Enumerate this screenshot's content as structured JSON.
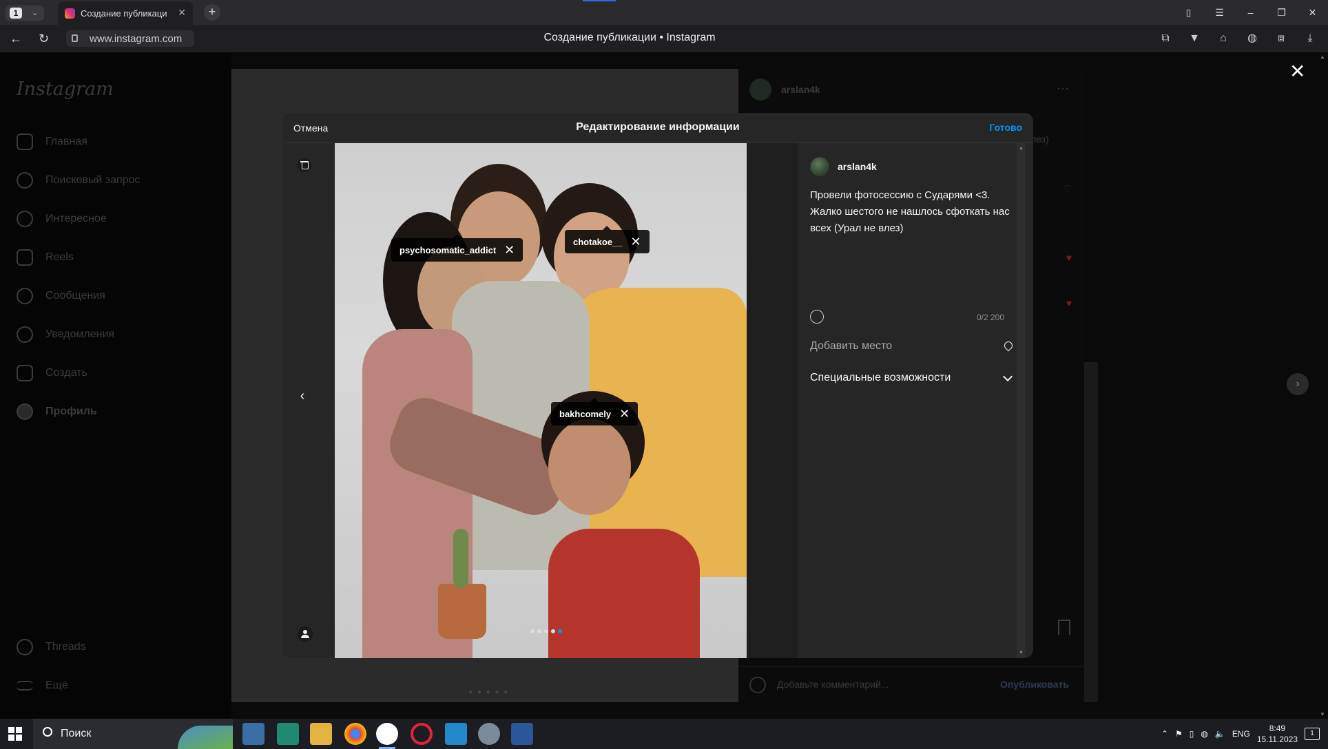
{
  "browser": {
    "tab_count": "1",
    "tab_title": "Создание публикаци",
    "url": "www.instagram.com",
    "page_title": "Создание публикации • Instagram"
  },
  "sidebar": {
    "logo": "Instagram",
    "items": [
      {
        "label": "Главная",
        "icon": "home-icon"
      },
      {
        "label": "Поисковый запрос",
        "icon": "search-icon"
      },
      {
        "label": "Интересное",
        "icon": "compass-icon"
      },
      {
        "label": "Reels",
        "icon": "reels-icon"
      },
      {
        "label": "Сообщения",
        "icon": "messenger-icon"
      },
      {
        "label": "Уведомления",
        "icon": "heart-icon"
      },
      {
        "label": "Создать",
        "icon": "plus-icon"
      },
      {
        "label": "Профиль",
        "icon": "avatar"
      }
    ],
    "bottom": [
      {
        "label": "Threads",
        "icon": "threads-icon"
      },
      {
        "label": "Ещё",
        "icon": "menu-icon"
      }
    ]
  },
  "background_post": {
    "username": "arslan4k",
    "text_peek": "лез)",
    "comment_placeholder": "Добавьте комментарий...",
    "publish_label": "Опубликовать"
  },
  "dialog": {
    "cancel_label": "Отмена",
    "title": "Редактирование информации",
    "done_label": "Готово",
    "username": "arslan4k",
    "caption": "Провели фотосессию с Сударями <3. Жалко шестого не нашлось сфоткать нас всех (Урал не влез)",
    "char_counter": "0/2 200",
    "location_placeholder": "Добавить место",
    "accessibility_label": "Специальные возможности",
    "tags": [
      {
        "label": "psychosomatic_addict"
      },
      {
        "label": "chotakoe__"
      },
      {
        "label": "bakhcomely"
      }
    ],
    "carousel": {
      "total": 5,
      "active_index": 4
    }
  },
  "taskbar": {
    "search_label": "Поиск",
    "language": "ENG",
    "time": "8:49",
    "date": "15.11.2023",
    "notification_count": "1"
  },
  "colors": {
    "accent_blue": "#0095f6",
    "dialog_bg": "#262626"
  }
}
